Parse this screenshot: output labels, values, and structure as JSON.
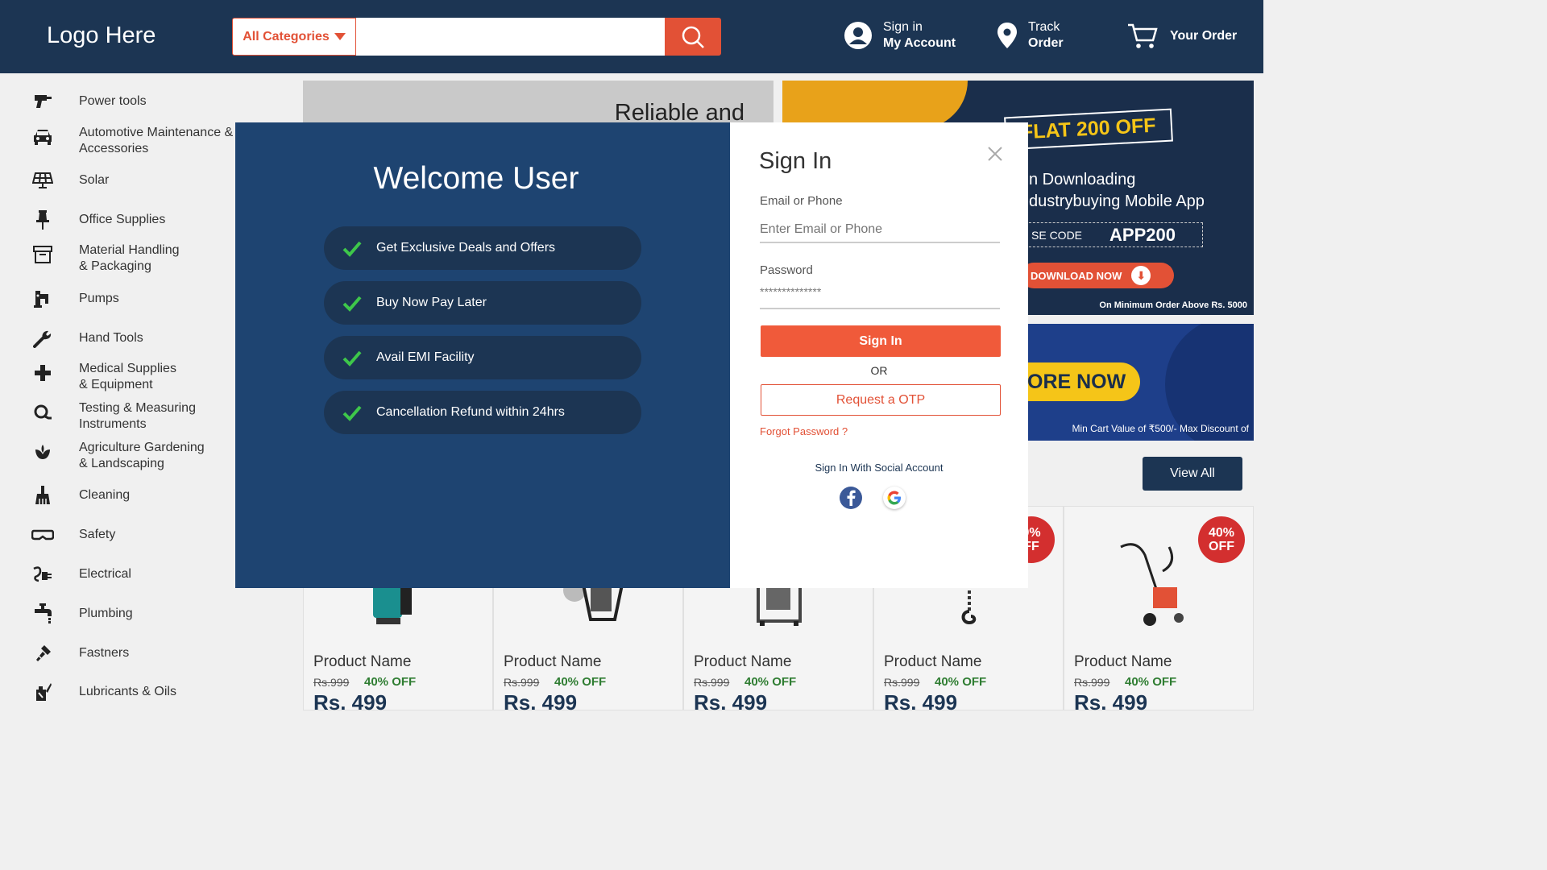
{
  "header": {
    "logo": "Logo Here",
    "category_label": "All Categories",
    "search_placeholder": "",
    "signin_line1": "Sign in",
    "signin_line2": "My Account",
    "track_line1": "Track",
    "track_line2": "Order",
    "order_label": "Your Order"
  },
  "sidebar": {
    "items": [
      {
        "label": "Power tools",
        "icon": "drill-icon"
      },
      {
        "label": "Automotive Maintenance &",
        "label2": "Accessories",
        "icon": "car-icon"
      },
      {
        "label": "Solar",
        "icon": "solar-panel-icon"
      },
      {
        "label": "Office Supplies",
        "icon": "pin-icon"
      },
      {
        "label": "Material Handling",
        "label2": "& Packaging",
        "icon": "box-icon"
      },
      {
        "label": "Pumps",
        "icon": "pump-icon"
      },
      {
        "label": "Hand Tools",
        "icon": "wrench-icon"
      },
      {
        "label": "Medical Supplies",
        "label2": "& Equipment",
        "icon": "medical-cross-icon"
      },
      {
        "label": "Testing & Measuring",
        "label2": "Instruments",
        "icon": "magnifier-icon"
      },
      {
        "label": "Agriculture Gardening",
        "label2": "& Landscaping",
        "icon": "plant-icon"
      },
      {
        "label": "Cleaning",
        "icon": "broom-icon"
      },
      {
        "label": "Safety",
        "icon": "goggles-icon"
      },
      {
        "label": "Electrical",
        "icon": "plug-icon"
      },
      {
        "label": "Plumbing",
        "icon": "faucet-icon"
      },
      {
        "label": "Fastners",
        "icon": "screw-icon"
      },
      {
        "label": "Lubricants & Oils",
        "icon": "oil-can-icon"
      }
    ]
  },
  "banners": {
    "left_text": "Reliable and",
    "flat_offer": "FLAT 200 OFF",
    "line1": "n Downloading",
    "line2": "dustrybuying Mobile App",
    "code_label": "SE CODE",
    "code_value": "APP200",
    "download_label": "DOWNLOAD NOW",
    "footnote1": "On Minimum Order Above Rs. 5000",
    "explore_label": "ORE NOW",
    "footnote2": "Min Cart Value of ₹500/- Max Discount of"
  },
  "view_all": "View All",
  "products": [
    {
      "name": "Product Name",
      "old_price": "Rs.999",
      "discount": "40% OFF",
      "price": "Rs. 499",
      "badge1": "",
      "badge2": ""
    },
    {
      "name": "Product Name",
      "old_price": "Rs.999",
      "discount": "40% OFF",
      "price": "Rs. 499",
      "badge1": "",
      "badge2": ""
    },
    {
      "name": "Product Name",
      "old_price": "Rs.999",
      "discount": "40% OFF",
      "price": "Rs. 499",
      "badge1": "",
      "badge2": ""
    },
    {
      "name": "Product Name",
      "old_price": "Rs.999",
      "discount": "40% OFF",
      "price": "Rs. 499",
      "badge1": "0%",
      "badge2": "FF"
    },
    {
      "name": "Product Name",
      "old_price": "Rs.999",
      "discount": "40% OFF",
      "price": "Rs. 499",
      "badge1": "40%",
      "badge2": "OFF"
    }
  ],
  "modal": {
    "welcome": "Welcome User",
    "perks": [
      "Get Exclusive Deals and Offers",
      "Buy Now Pay Later",
      "Avail EMI Facility",
      "Cancellation Refund within 24hrs"
    ],
    "title": "Sign In",
    "email_label": "Email or Phone",
    "email_placeholder": "Enter Email or Phone",
    "password_label": "Password",
    "password_value": "**************",
    "signin_button": "Sign In",
    "or": "OR",
    "otp_button": "Request a OTP",
    "forgot": "Forgot Password ?",
    "social_text": "Sign In With Social Account"
  },
  "colors": {
    "header_bg": "#1c3553",
    "accent": "#e25136",
    "modal_left_bg": "#1e4471",
    "check_green": "#3ec74a"
  }
}
